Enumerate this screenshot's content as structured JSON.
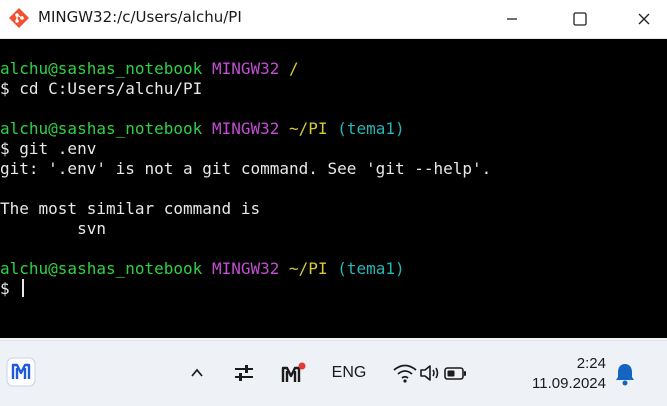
{
  "window": {
    "title": "MINGW32:/c/Users/alchu/PI",
    "icon": "git-bash-icon",
    "controls": [
      "minimize-icon",
      "maximize-icon",
      "close-icon"
    ]
  },
  "terminal": {
    "lines": [
      {
        "user": "alchu@sashas_notebook",
        "system": "MINGW32",
        "path": "/",
        "branch": ""
      },
      {
        "text": "$ cd C:Users/alchu/PI"
      },
      {
        "text": ""
      },
      {
        "user": "alchu@sashas_notebook",
        "system": "MINGW32",
        "path": "~/PI",
        "branch": "(tema1)"
      },
      {
        "text": "$ git .env"
      },
      {
        "text": "git: '.env' is not a git command. See 'git --help'."
      },
      {
        "text": ""
      },
      {
        "text": "The most similar command is"
      },
      {
        "text": "        svn"
      },
      {
        "text": ""
      },
      {
        "user": "alchu@sashas_notebook",
        "system": "MINGW32",
        "path": "~/PI",
        "branch": "(tema1)"
      },
      {
        "text": "$ "
      }
    ],
    "colors": {
      "user": "#2fd145",
      "system": "#c34dd4",
      "path": "#d6c93c",
      "branch": "#27b5b5",
      "text": "#e8e8e8",
      "background": "#000000"
    }
  },
  "taskbar": {
    "app_icon": "app-logo-icon",
    "tray_icons": [
      "chevron-up-icon",
      "settings-sliders-icon",
      "app-m-icon"
    ],
    "language": "ENG",
    "status_icons": [
      "wifi-icon",
      "volume-icon",
      "battery-icon"
    ],
    "time": "2:24",
    "date": "11.09.2024",
    "notification_icon": "bell-icon",
    "accent": "#1565c0",
    "badge_color": "#e53935"
  }
}
